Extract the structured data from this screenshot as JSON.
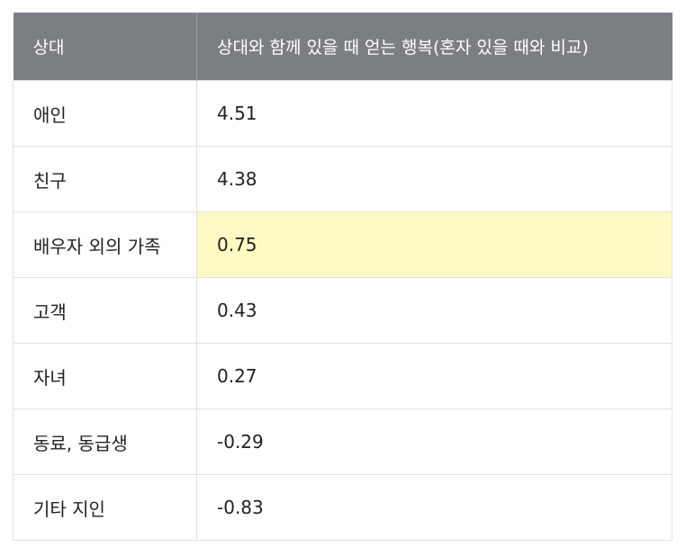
{
  "table": {
    "headers": [
      "상대",
      "상대와 함께 있을 때 얻는 행복(혼자 있을 때와 비교)"
    ],
    "rows": [
      {
        "name": "애인",
        "value": "4.51",
        "highlight": false
      },
      {
        "name": "친구",
        "value": "4.38",
        "highlight": false
      },
      {
        "name": "배우자 외의 가족",
        "value": "0.75",
        "highlight": true
      },
      {
        "name": "고객",
        "value": "0.43",
        "highlight": false
      },
      {
        "name": "자녀",
        "value": "0.27",
        "highlight": false
      },
      {
        "name": "동료, 동급생",
        "value": "-0.29",
        "highlight": false
      },
      {
        "name": "기타 지인",
        "value": "-0.83",
        "highlight": false
      }
    ]
  },
  "colors": {
    "header_bg": "#7b7f83",
    "highlight_bg": "#fff9c4"
  }
}
